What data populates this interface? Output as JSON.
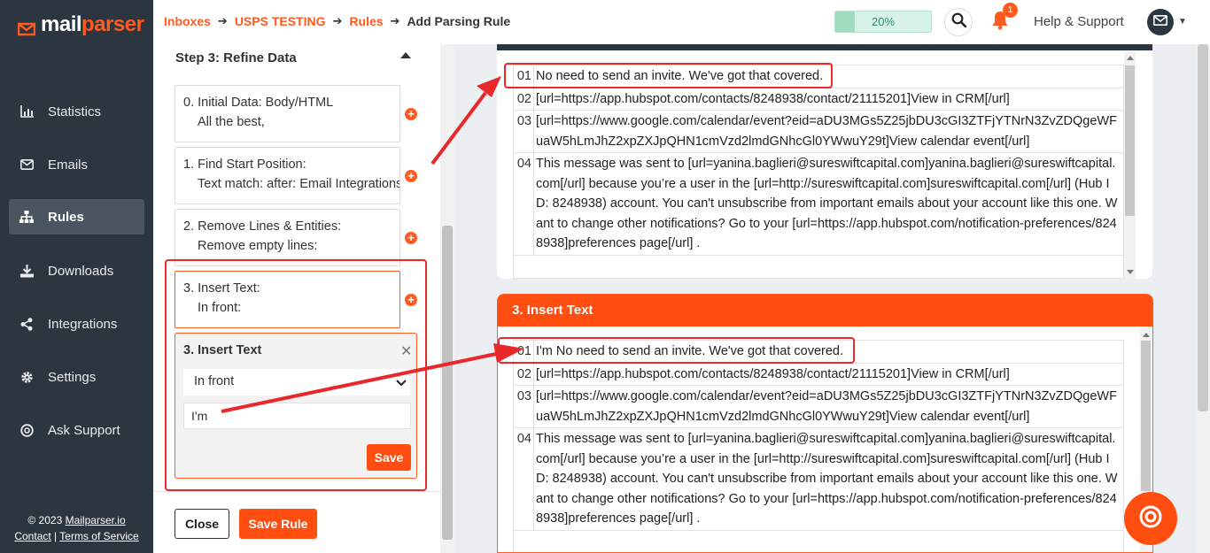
{
  "brand": {
    "name_part1": "mail",
    "name_part2": "parser",
    "accent": "#ff5a1f",
    "sidebar_bg": "#2c3640"
  },
  "sidebar": {
    "items": [
      {
        "label": "Statistics",
        "icon": "bar-chart-icon"
      },
      {
        "label": "Emails",
        "icon": "envelope-icon"
      },
      {
        "label": "Rules",
        "icon": "sitemap-icon",
        "active": true
      },
      {
        "label": "Downloads",
        "icon": "download-icon"
      },
      {
        "label": "Integrations",
        "icon": "share-icon"
      },
      {
        "label": "Settings",
        "icon": "gear-icon"
      },
      {
        "label": "Ask Support",
        "icon": "question-icon"
      }
    ],
    "footer": {
      "copyright": "© 2023",
      "site": "Mailparser.io",
      "contact": "Contact",
      "separator": "|",
      "terms": "Terms of Service"
    }
  },
  "header": {
    "breadcrumb": [
      "Inboxes",
      "USPS TESTING",
      "Rules",
      "Add Parsing Rule"
    ],
    "progress": {
      "label": "20%",
      "value": 0.2
    },
    "notifications_count": "1",
    "help_label": "Help & Support"
  },
  "panel": {
    "step_title": "Step 3: Refine Data",
    "steps": [
      {
        "line1": "0. Initial Data: Body/HTML",
        "line2": "All the best,"
      },
      {
        "line1": "1. Find Start Position:",
        "line2": "Text match: after: Email Integrations"
      },
      {
        "line1": "2. Remove Lines & Entities:",
        "line2": "Remove empty lines:"
      },
      {
        "line1": "3. Insert Text:",
        "line2": "In front:"
      }
    ],
    "edit": {
      "title": "3. Insert Text",
      "position_value": "In front",
      "text_value": "I'm",
      "save_label": "Save"
    },
    "close_label": "Close",
    "save_rule_label": "Save Rule"
  },
  "preview": {
    "rows": [
      {
        "num": "01",
        "text": "No need to send an invite. We've got that covered."
      },
      {
        "num": "02",
        "text": "[url=https://app.hubspot.com/contacts/8248938/contact/21115201]View in CRM[/url]"
      },
      {
        "num": "03",
        "text": "[url=https://www.google.com/calendar/event?eid=aDU3MGs5Z25jbDU3cGI3ZTFjYTNrN3ZvZDQgeWFuaW5hLmJhZ2xpZXJpQHN1cmVzd2lmdGNhcGl0YWwuY29t]View calendar event[/url]"
      },
      {
        "num": "04",
        "text": "This message was sent to [url=yanina.baglieri@sureswiftcapital.com]yanina.baglieri@sureswiftcapital.com[/url] because you’re a user in the [url=http://sureswiftcapital.com]sureswiftcapital.com[/url] (Hub ID: 8248938) account. You can't unsubscribe from important emails about your account like this one. Want to change other notifications? Go to your [url=https://app.hubspot.com/notification-preferences/8248938]preferences page[/url] ."
      }
    ]
  },
  "insert_result": {
    "title": "3. Insert Text",
    "rows": [
      {
        "num": "01",
        "text": "I'm No need to send an invite. We've got that covered."
      },
      {
        "num": "02",
        "text": "[url=https://app.hubspot.com/contacts/8248938/contact/21115201]View in CRM[/url]"
      },
      {
        "num": "03",
        "text": "[url=https://www.google.com/calendar/event?eid=aDU3MGs5Z25jbDU3cGI3ZTFjYTNrN3ZvZDQgeWFuaW5hLmJhZ2xpZXJpQHN1cmVzd2lmdGNhcGl0YWwuY29t]View calendar event[/url]"
      },
      {
        "num": "04",
        "text": "This message was sent to [url=yanina.baglieri@sureswiftcapital.com]yanina.baglieri@sureswiftcapital.com[/url] because you’re a user in the [url=http://sureswiftcapital.com]sureswiftcapital.com[/url] (Hub ID: 8248938) account. You can't unsubscribe from important emails about your account like this one. Want to change other notifications? Go to your [url=https://app.hubspot.com/notification-preferences/8248938]preferences page[/url] ."
      }
    ]
  }
}
